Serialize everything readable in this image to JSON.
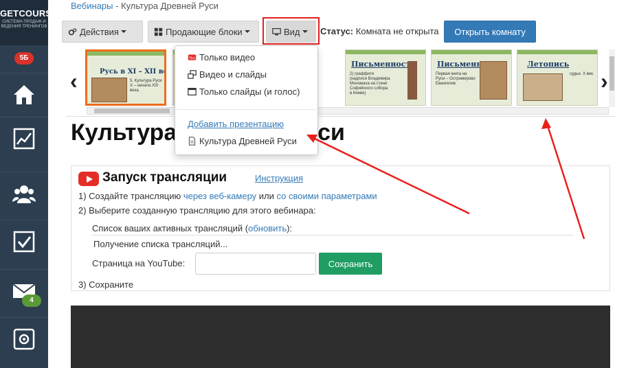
{
  "sidebar": {
    "logo_brand_a": "GET",
    "logo_brand_b": "COURSE",
    "logo_tagline": "СИСТЕМА ПРОДАЖ И ВЕДЕНИЯ ТРЕНИНГОВ",
    "top_badge": "5Б",
    "mail_badge": "4"
  },
  "breadcrumb": {
    "link": "Вебинары",
    "separator": " - ",
    "current": "Культура Древней Руси"
  },
  "toolbar": {
    "actions_label": "Действия",
    "blocks_label": "Продающие блоки",
    "view_label": "Вид",
    "status_label": "Статус:",
    "status_value": "Комната не открыта",
    "open_room_label": "Открыть комнату"
  },
  "slides": [
    {
      "title": "Русь в XI – XII веках.",
      "text": "5. Культура Руси X – начала XIII века."
    },
    {
      "title": "",
      "text": ""
    },
    {
      "title": "Письменность",
      "text": "2) граффити (надписи Владимира Мономаха на стене Софийского собора в Киеве)"
    },
    {
      "title": "Письменность",
      "text": "Первая книга на Руси – Остромирово Евангелие"
    },
    {
      "title": "Летопись",
      "text": "судьи. X век."
    }
  ],
  "view_menu": {
    "items": [
      "Только видео",
      "Видео и слайды",
      "Только слайды (и голос)"
    ],
    "add_presentation": "Добавить презентацию",
    "presentation": "Культура Древней Руси"
  },
  "page_title": "Культура Древней Руси",
  "broadcast": {
    "title": "Запуск трансляции",
    "instruction_link": "Инструкция",
    "step1_prefix": "1) Создайте трансляцию ",
    "step1_link1": "через веб-камеру",
    "step1_mid": " или ",
    "step1_link2": "со своими параметрами",
    "step2": "2) Выберите созданную трансляцию для этого вебинара:",
    "list_prefix": "Список ваших активных трансляций (",
    "list_link": "обновить",
    "list_suffix": "):",
    "loading": "Получение списка трансляций...",
    "page_label": "Страница на YouTube:",
    "page_value": "",
    "save_label": "Сохранить",
    "step3": "3) Сохраните"
  },
  "colors": {
    "sidebar": "#2c3e50",
    "primary": "#337ab7",
    "success": "#1f9d63",
    "highlight": "#e02020"
  }
}
